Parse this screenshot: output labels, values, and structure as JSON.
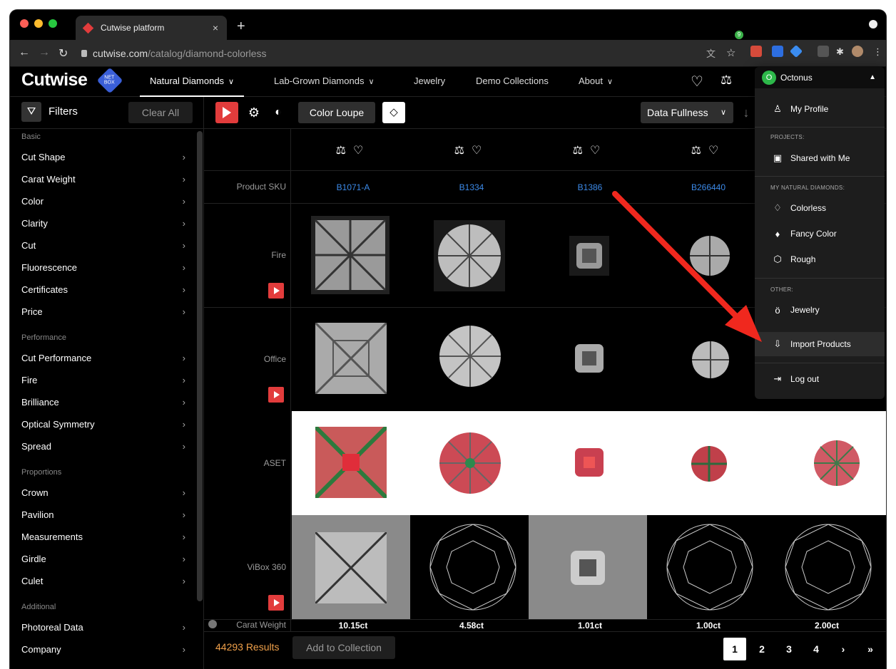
{
  "browser": {
    "tab_title": "Cutwise platform",
    "url_host": "cutwise.com",
    "url_path": "/catalog/diamond-colorless"
  },
  "header": {
    "logo": "Cutwise",
    "logo_badge": "NET BOX",
    "menu": [
      {
        "label": "Natural Diamonds",
        "active": true,
        "chevron": true
      },
      {
        "label": "Lab-Grown Diamonds",
        "chevron": true
      },
      {
        "label": "Jewelry"
      },
      {
        "label": "Demo Collections"
      },
      {
        "label": "About",
        "chevron": true
      }
    ],
    "compare_count": "9"
  },
  "user_menu": {
    "avatar": "O",
    "name": "Octonus",
    "my_profile": "My Profile",
    "projects_heading": "PROJECTS:",
    "shared": "Shared with Me",
    "my_natural_heading": "MY NATURAL DIAMONDS:",
    "colorless": "Colorless",
    "fancy": "Fancy Color",
    "rough": "Rough",
    "other_heading": "OTHER:",
    "jewelry": "Jewelry",
    "import": "Import Products",
    "logout": "Log out"
  },
  "sidebar": {
    "filters_label": "Filters",
    "clear_all": "Clear All",
    "sections": [
      {
        "heading": "Basic",
        "items": [
          "Cut Shape",
          "Carat Weight",
          "Color",
          "Clarity",
          "Cut",
          "Fluorescence",
          "Certificates",
          "Price"
        ]
      },
      {
        "heading": "Performance",
        "items": [
          "Cut Performance",
          "Fire",
          "Brilliance",
          "Optical Symmetry",
          "Spread"
        ]
      },
      {
        "heading": "Proportions",
        "items": [
          "Crown",
          "Pavilion",
          "Measurements",
          "Girdle",
          "Culet"
        ]
      },
      {
        "heading": "Additional",
        "items": [
          "Photoreal Data",
          "Company"
        ]
      }
    ]
  },
  "toolbar": {
    "color_loupe": "Color Loupe",
    "sort_label": "Data Fullness"
  },
  "grid": {
    "row_labels": {
      "sku": "Product SKU",
      "fire": "Fire",
      "office": "Office",
      "aset": "ASET",
      "vibox": "ViBox 360",
      "carat": "Carat Weight"
    },
    "skus": [
      "B1071-A",
      "B1334",
      "B1386",
      "B266440"
    ],
    "carats": [
      "10.15ct",
      "4.58ct",
      "1.01ct",
      "1.00ct",
      "2.00ct"
    ]
  },
  "footer": {
    "results": "44293 Results",
    "add_to_collection": "Add to Collection",
    "pages": [
      "1",
      "2",
      "3",
      "4",
      "›",
      "»"
    ]
  },
  "colors": {
    "accent_red": "#e23c3c",
    "link_blue": "#3c8ae8",
    "results_orange": "#f0a04a",
    "avatar_green": "#2db84a"
  }
}
